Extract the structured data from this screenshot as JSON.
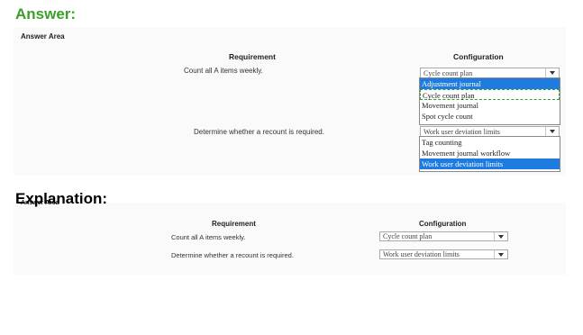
{
  "answer_heading": "Answer:",
  "explanation_heading": "Explanation:",
  "answer_area": {
    "label": "Answer Area",
    "requirement_header": "Requirement",
    "configuration_header": "Configuration",
    "rows": [
      {
        "requirement": "Count all A items weekly.",
        "selected": "Cycle count plan",
        "options": [
          "Adjustment journal",
          "Cycle count plan",
          "Movement journal",
          "Spot cycle count"
        ]
      },
      {
        "requirement": "Determine whether a recount is required.",
        "selected": "Work user deviation limits",
        "options": [
          "Tag counting",
          "Movement journal workflow",
          "Work user deviation limits"
        ]
      }
    ]
  },
  "explanation_area": {
    "label": "Answer Area",
    "requirement_header": "Requirement",
    "configuration_header": "Configuration",
    "rows": [
      {
        "requirement": "Count all A items weekly.",
        "selected": "Cycle count plan"
      },
      {
        "requirement": "Determine whether a recount is required.",
        "selected": "Work user deviation limits"
      }
    ]
  },
  "colors": {
    "answer_heading": "#3aa02a",
    "highlight": "#1e7be0",
    "answer_marker": "#3a9a3a"
  }
}
